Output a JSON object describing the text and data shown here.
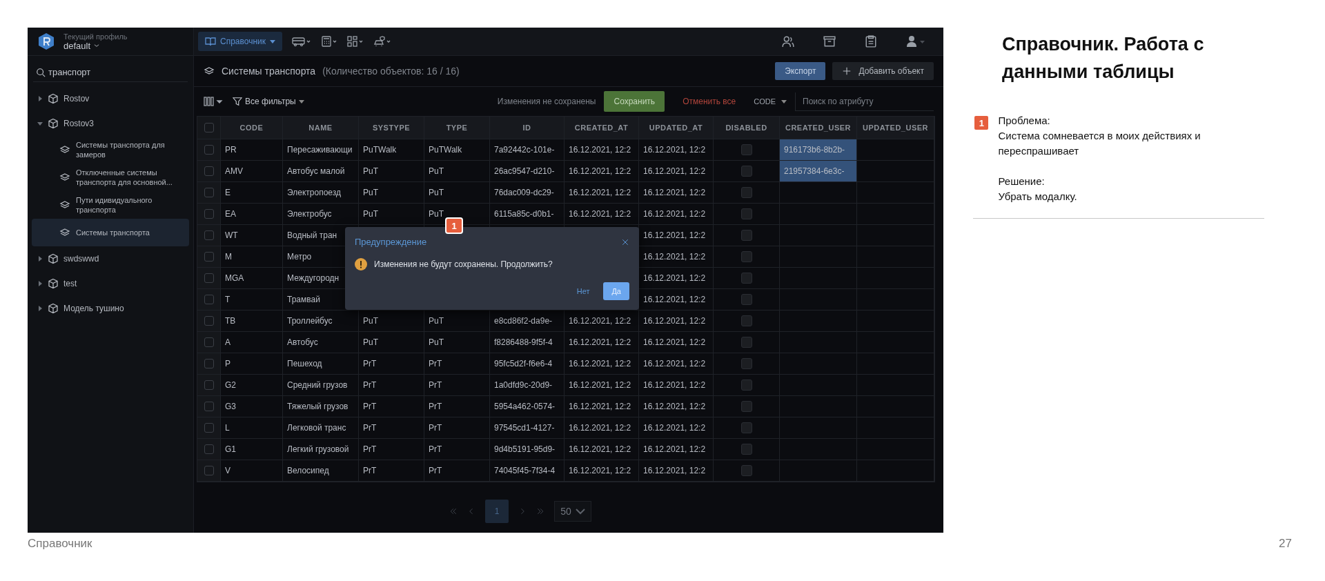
{
  "sidebar": {
    "profile_label": "Текущий профиль",
    "profile": "default",
    "search": "транспорт",
    "tree": [
      {
        "label": "Rostov",
        "expanded": false,
        "selected": false
      },
      {
        "label": "Rostov3",
        "expanded": true,
        "selected": false,
        "children": [
          {
            "label": "Системы транспорта для замеров",
            "selected": false
          },
          {
            "label": "Отключенные системы транспорта для основной...",
            "selected": false
          },
          {
            "label": "Пути идивидуального транспорта",
            "selected": false
          },
          {
            "label": "Системы транспорта",
            "selected": true
          }
        ]
      },
      {
        "label": "swdswwd",
        "expanded": false,
        "selected": false
      },
      {
        "label": "test",
        "expanded": false,
        "selected": false
      },
      {
        "label": "Модель тушино",
        "expanded": false,
        "selected": false
      }
    ]
  },
  "nav_menus": [
    {
      "label": "Справочник",
      "selected": true
    }
  ],
  "page": {
    "title": "Системы транспорта",
    "count": "(Количество объектов: 16 / 16)",
    "export": "Экспорт",
    "add": "Добавить объект"
  },
  "toolbar": {
    "filters": "Все фильтры",
    "status": "Изменения не сохранены",
    "save": "Сохранить",
    "cancel": "Отменить все",
    "attribute": "CODE",
    "search_placeholder": "Поиск по атрибуту"
  },
  "table": {
    "all_selected": false,
    "columns": [
      "CODE",
      "NAME",
      "SYSTYPE",
      "TYPE",
      "ID",
      "CREATED_AT",
      "UPDATED_AT",
      "DISABLED",
      "CREATED_USER",
      "UPDATED_USER"
    ],
    "rows": [
      {
        "selected": false,
        "code": "PR",
        "name": "Пересаживающи",
        "systype": "PuTWalk",
        "type": "PuTWalk",
        "id": "7a92442c-101e-",
        "created_at": "16.12.2021, 12:2",
        "updated_at": "16.12.2021, 12:2",
        "disabled": false,
        "created_user": "916173b6-8b2b-",
        "created_user_selected": true
      },
      {
        "selected": false,
        "code": "AMV",
        "name": "Автобус малой",
        "systype": "PuT",
        "type": "PuT",
        "id": "26ac9547-d210-",
        "created_at": "16.12.2021, 12:2",
        "updated_at": "16.12.2021, 12:2",
        "disabled": false,
        "created_user": "21957384-6e3c-",
        "created_user_selected": true
      },
      {
        "selected": false,
        "code": "E",
        "name": "Электропоезд",
        "systype": "PuT",
        "type": "PuT",
        "id": "76dac009-dc29-",
        "created_at": "16.12.2021, 12:2",
        "updated_at": "16.12.2021, 12:2",
        "disabled": false,
        "created_user_selected": false
      },
      {
        "selected": false,
        "code": "EA",
        "name": "Электробус",
        "systype": "PuT",
        "type": "PuT",
        "id": "6115a85c-d0b1-",
        "created_at": "16.12.2021, 12:2",
        "updated_at": "16.12.2021, 12:2",
        "disabled": false,
        "created_user_selected": false
      },
      {
        "selected": false,
        "code": "WT",
        "name": "Водный тран",
        "updated_at": "16.12.2021, 12:2",
        "disabled": false,
        "created_user_selected": false
      },
      {
        "selected": false,
        "code": "M",
        "name": "Метро",
        "updated_at": "16.12.2021, 12:2",
        "disabled": false,
        "created_user_selected": false
      },
      {
        "selected": false,
        "code": "MGA",
        "name": "Междугородн",
        "updated_at": "16.12.2021, 12:2",
        "disabled": false,
        "created_user_selected": false
      },
      {
        "selected": false,
        "code": "T",
        "name": "Трамвай",
        "updated_at": "16.12.2021, 12:2",
        "disabled": false,
        "created_user_selected": false
      },
      {
        "selected": false,
        "code": "TB",
        "name": "Троллейбус",
        "systype": "PuT",
        "type": "PuT",
        "id": "e8cd86f2-da9e-",
        "created_at": "16.12.2021, 12:2",
        "updated_at": "16.12.2021, 12:2",
        "disabled": false,
        "created_user_selected": false
      },
      {
        "selected": false,
        "code": "A",
        "name": "Автобус",
        "systype": "PuT",
        "type": "PuT",
        "id": "f8286488-9f5f-4",
        "created_at": "16.12.2021, 12:2",
        "updated_at": "16.12.2021, 12:2",
        "disabled": false,
        "created_user_selected": false
      },
      {
        "selected": false,
        "code": "P",
        "name": "Пешеход",
        "systype": "PrT",
        "type": "PrT",
        "id": "95fc5d2f-f6e6-4",
        "created_at": "16.12.2021, 12:2",
        "updated_at": "16.12.2021, 12:2",
        "disabled": false,
        "created_user_selected": false
      },
      {
        "selected": false,
        "code": "G2",
        "name": "Средний грузов",
        "systype": "PrT",
        "type": "PrT",
        "id": "1a0dfd9c-20d9-",
        "created_at": "16.12.2021, 12:2",
        "updated_at": "16.12.2021, 12:2",
        "disabled": false,
        "created_user_selected": false
      },
      {
        "selected": false,
        "code": "G3",
        "name": "Тяжелый грузов",
        "systype": "PrT",
        "type": "PrT",
        "id": "5954a462-0574-",
        "created_at": "16.12.2021, 12:2",
        "updated_at": "16.12.2021, 12:2",
        "disabled": false,
        "created_user_selected": false
      },
      {
        "selected": false,
        "code": "L",
        "name": "Легковой транс",
        "systype": "PrT",
        "type": "PrT",
        "id": "97545cd1-4127-",
        "created_at": "16.12.2021, 12:2",
        "updated_at": "16.12.2021, 12:2",
        "disabled": false,
        "created_user_selected": false
      },
      {
        "selected": false,
        "code": "G1",
        "name": "Легкий грузовой",
        "systype": "PrT",
        "type": "PrT",
        "id": "9d4b5191-95d9-",
        "created_at": "16.12.2021, 12:2",
        "updated_at": "16.12.2021, 12:2",
        "disabled": false,
        "created_user_selected": false
      },
      {
        "selected": false,
        "code": "V",
        "name": "Велосипед",
        "systype": "PrT",
        "type": "PrT",
        "id": "74045f45-7f34-4",
        "created_at": "16.12.2021, 12:2",
        "updated_at": "16.12.2021, 12:2",
        "disabled": false,
        "created_user_selected": false
      }
    ]
  },
  "dialog": {
    "title": "Предупреждение",
    "message": "Изменения не будут сохранены. Продолжить?",
    "no": "Нет",
    "yes": "Да",
    "badge": "1"
  },
  "pagination": {
    "pages": [
      {
        "label": "1",
        "selected": true
      }
    ],
    "page_size": "50"
  },
  "slide": {
    "heading": "Справочник. Работа с данными таблицы",
    "badge": "1",
    "problem_label": "Проблема:",
    "problem": "Система сомневается в моих действиях и переспрашивает",
    "solution_label": "Решение:",
    "solution": "Убрать модалку.",
    "footer": "Справочник",
    "page_number": "27"
  }
}
